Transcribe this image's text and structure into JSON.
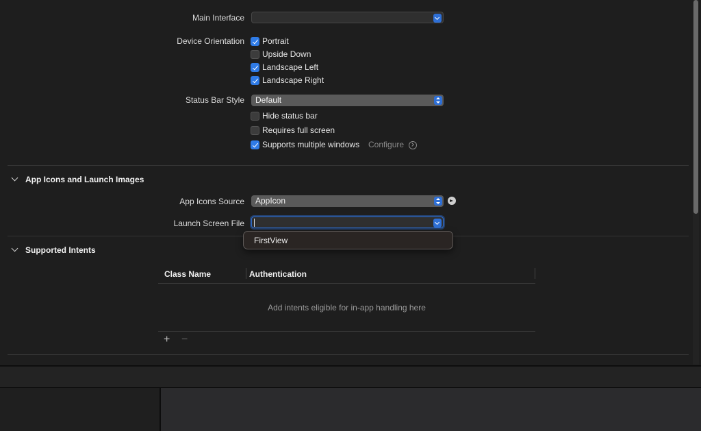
{
  "settings": {
    "main_interface_label": "Main Interface",
    "main_interface_value": "",
    "device_orientation_label": "Device Orientation",
    "orientations": [
      {
        "label": "Portrait",
        "checked": true
      },
      {
        "label": "Upside Down",
        "checked": false
      },
      {
        "label": "Landscape Left",
        "checked": true
      },
      {
        "label": "Landscape Right",
        "checked": true
      }
    ],
    "status_bar_style_label": "Status Bar Style",
    "status_bar_style_value": "Default",
    "hide_status_bar_label": "Hide status bar",
    "requires_full_screen_label": "Requires full screen",
    "supports_multiple_windows_label": "Supports multiple windows",
    "configure_label": "Configure"
  },
  "app_icons": {
    "section_title": "App Icons and Launch Images",
    "app_icons_source_label": "App Icons Source",
    "app_icons_source_value": "AppIcon",
    "launch_screen_file_label": "Launch Screen File",
    "launch_screen_file_value": "",
    "dropdown_options": [
      "FirstView"
    ]
  },
  "supported_intents": {
    "section_title": "Supported Intents",
    "columns": [
      "Class Name",
      "Authentication"
    ],
    "empty_message": "Add intents eligible for in-app handling here",
    "add_symbol": "+",
    "remove_symbol": "−"
  },
  "colors": {
    "accent": "#2f7be6",
    "background": "#1e1e1e"
  }
}
